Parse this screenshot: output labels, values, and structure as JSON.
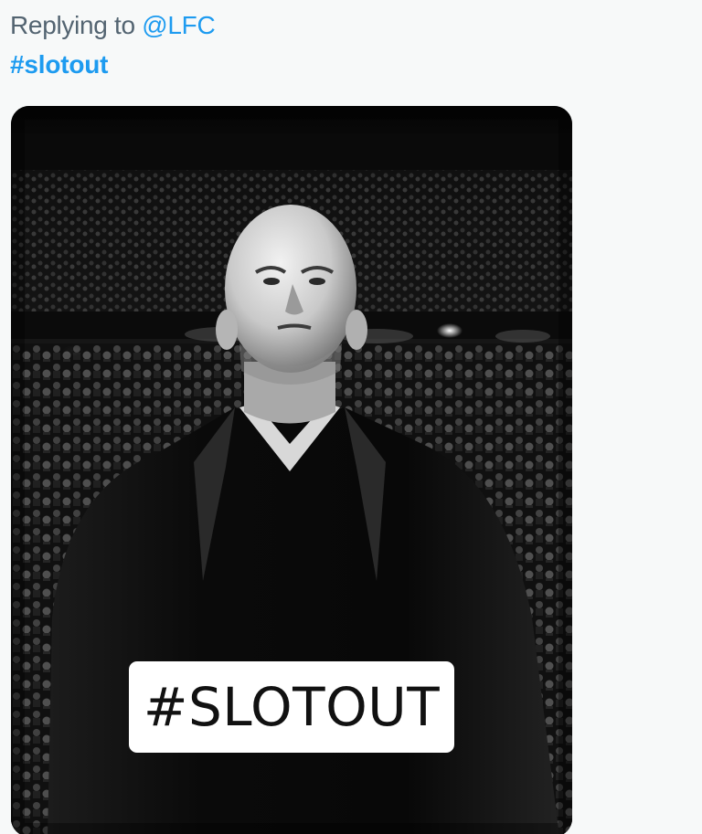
{
  "reply": {
    "prefix": "Replying to",
    "handle": "@LFC"
  },
  "tweet": {
    "text": "#slotout"
  },
  "media": {
    "type": "photo",
    "overlay_text": "#SLOTOUT"
  },
  "colors": {
    "link": "#1d9bf0",
    "secondary_text": "#536471",
    "background": "#f7f9f9"
  }
}
